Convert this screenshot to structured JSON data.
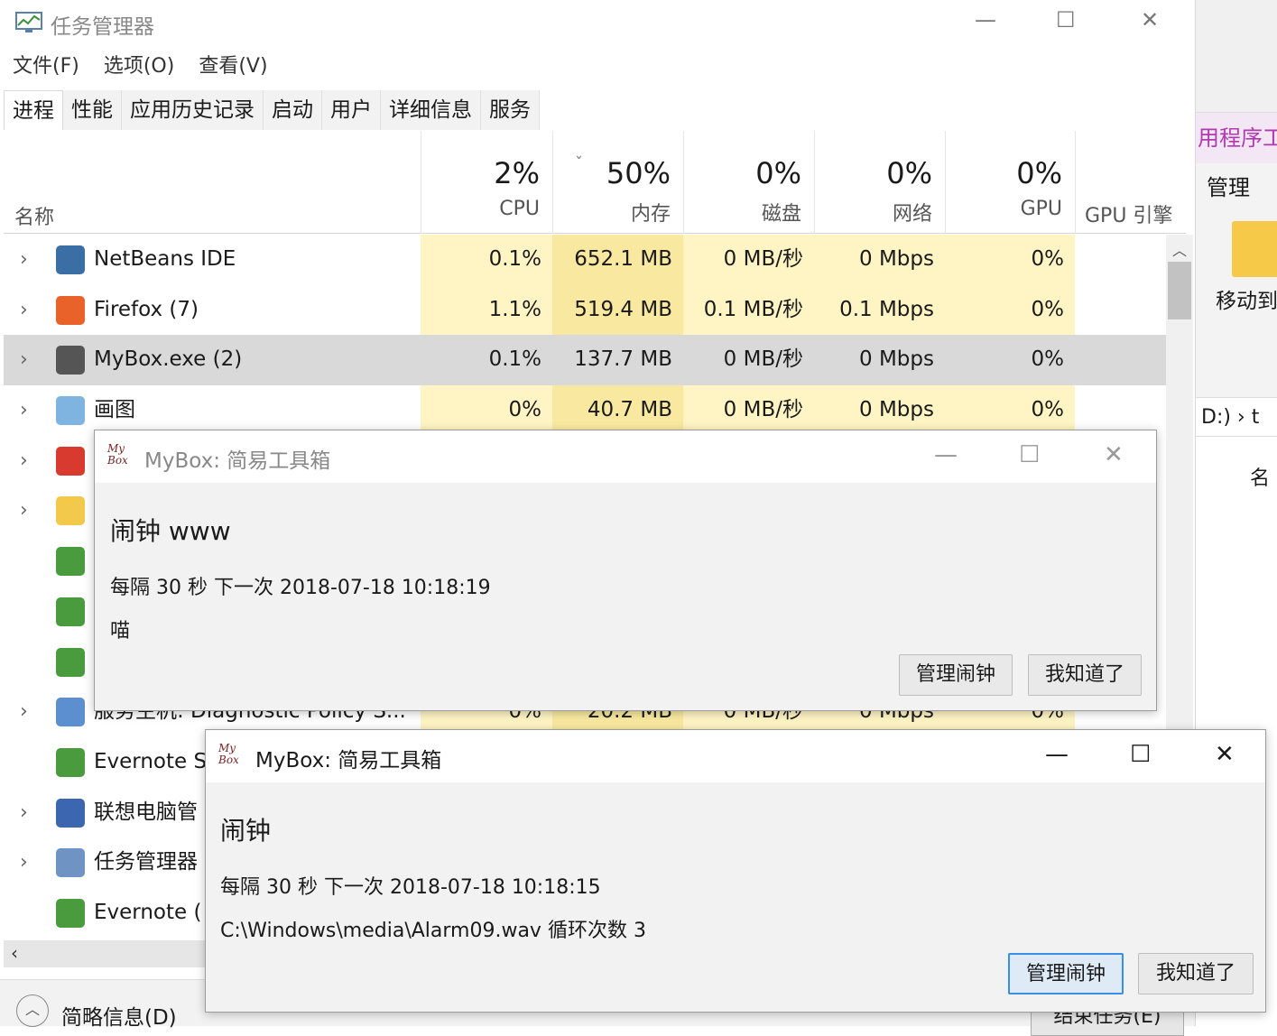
{
  "taskmgr": {
    "title": "任务管理器",
    "menu": [
      "文件(F)",
      "选项(O)",
      "查看(V)"
    ],
    "tabs": [
      "进程",
      "性能",
      "应用历史记录",
      "启动",
      "用户",
      "详细信息",
      "服务"
    ],
    "columns": {
      "name": "名称",
      "cpu": {
        "pct": "2%",
        "label": "CPU"
      },
      "mem": {
        "pct": "50%",
        "label": "内存"
      },
      "disk": {
        "pct": "0%",
        "label": "磁盘"
      },
      "net": {
        "pct": "0%",
        "label": "网络"
      },
      "gpu": {
        "pct": "0%",
        "label": "GPU"
      },
      "gpueng": {
        "label": "GPU 引擎"
      }
    },
    "rows": [
      {
        "name": "NetBeans IDE",
        "cpu": "0.1%",
        "mem": "652.1 MB",
        "disk": "0 MB/秒",
        "net": "0 Mbps",
        "gpu": "0%",
        "icon": "netbeans-icon"
      },
      {
        "name": "Firefox (7)",
        "cpu": "1.1%",
        "mem": "519.4 MB",
        "disk": "0.1 MB/秒",
        "net": "0.1 Mbps",
        "gpu": "0%",
        "icon": "firefox-icon"
      },
      {
        "name": "MyBox.exe (2)",
        "cpu": "0.1%",
        "mem": "137.7 MB",
        "disk": "0 MB/秒",
        "net": "0 Mbps",
        "gpu": "0%",
        "icon": "mybox-icon"
      },
      {
        "name": "画图",
        "cpu": "0%",
        "mem": "40.7 MB",
        "disk": "0 MB/秒",
        "net": "0 Mbps",
        "gpu": "0%",
        "icon": "paint-icon"
      },
      {
        "name": "",
        "icon": "netease-music-icon"
      },
      {
        "name": "",
        "icon": "folder-icon"
      },
      {
        "name": "",
        "icon": "evernote-icon"
      },
      {
        "name": "",
        "icon": "evernote-icon"
      },
      {
        "name": "",
        "icon": "evernote-icon"
      },
      {
        "name": "服务主机: Diagnostic Policy S...",
        "cpu": "0%",
        "mem": "20.2 MB",
        "disk": "0 MB/秒",
        "net": "0 Mbps",
        "gpu": "0%",
        "icon": "gear-icon"
      },
      {
        "name": "Evernote S",
        "icon": "evernote-icon"
      },
      {
        "name": "联想电脑管",
        "icon": "lenovo-icon"
      },
      {
        "name": "任务管理器",
        "icon": "taskmgr-icon"
      },
      {
        "name": "Evernote (",
        "icon": "evernote-icon"
      }
    ],
    "bottom": {
      "summary": "简略信息(D)",
      "end_task": "结束任务(E)"
    }
  },
  "background_window": {
    "ribbon_tab": "用程序工",
    "manage": "管理",
    "move_label": "移动到",
    "path": "D:) › t",
    "col": "名"
  },
  "dialog1": {
    "title": "MyBox: 简易工具箱",
    "heading": "闹钟  www",
    "line1": "每隔 30 秒     下一次 2018-07-18 10:18:19",
    "line2": "喵",
    "btn_manage": "管理闹钟",
    "btn_ok": "我知道了"
  },
  "dialog2": {
    "title": "MyBox: 简易工具箱",
    "heading": "闹钟",
    "line1": "每隔 30 秒     下一次 2018-07-18 10:18:15",
    "line2": "C:\\Windows\\media\\Alarm09.wav   循环次数 3",
    "btn_manage": "管理闹钟",
    "btn_ok": "我知道了"
  },
  "logo_text": "My Box",
  "colors": {
    "heat_light": "#fff4c4",
    "heat_strong": "#f9e9a0",
    "selected_row": "#d9d9d9",
    "focus_border": "#3a8ee6"
  }
}
